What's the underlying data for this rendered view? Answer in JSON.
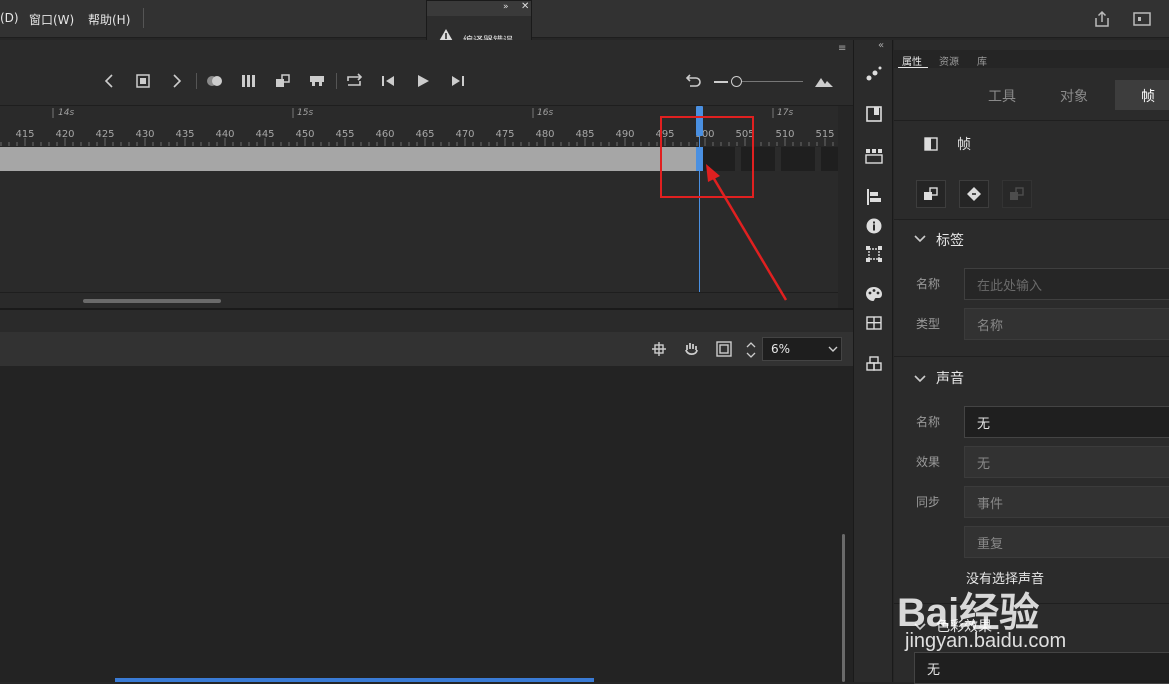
{
  "menu": {
    "items": [
      "(D)",
      "窗口(W)",
      "帮助(H)"
    ]
  },
  "compiler_panel": {
    "label": "编译器错误"
  },
  "timeline": {
    "section_labels": [
      "14s",
      "15s",
      "16s",
      "17s"
    ],
    "frame_numbers": [
      "415",
      "420",
      "425",
      "430",
      "435",
      "440",
      "445",
      "450",
      "455",
      "460",
      "465",
      "470",
      "475",
      "480",
      "485",
      "490",
      "495",
      "500",
      "505",
      "510",
      "515"
    ]
  },
  "stage_toolbar": {
    "zoom": "6%"
  },
  "properties": {
    "tabs": [
      "属性",
      "资源",
      "库"
    ],
    "segments": [
      "工具",
      "对象",
      "帧"
    ],
    "frame_title": "帧",
    "label_section": {
      "title": "标签",
      "name_label": "名称",
      "name_placeholder": "在此处输入",
      "type_label": "类型",
      "type_value": "名称"
    },
    "sound_section": {
      "title": "声音",
      "name_label": "名称",
      "name_value": "无",
      "effect_label": "效果",
      "effect_value": "无",
      "sync_label": "同步",
      "sync_value": "事件",
      "repeat_value": "重复",
      "no_sound_text": "没有选择声音"
    },
    "color_section": {
      "title": "色彩效果",
      "value": "无"
    }
  },
  "watermark": {
    "brand": "Bai经验",
    "url": "jingyan.baidu.com"
  },
  "colors": {
    "accent": "#4a90e2",
    "highlight": "#e02020"
  }
}
